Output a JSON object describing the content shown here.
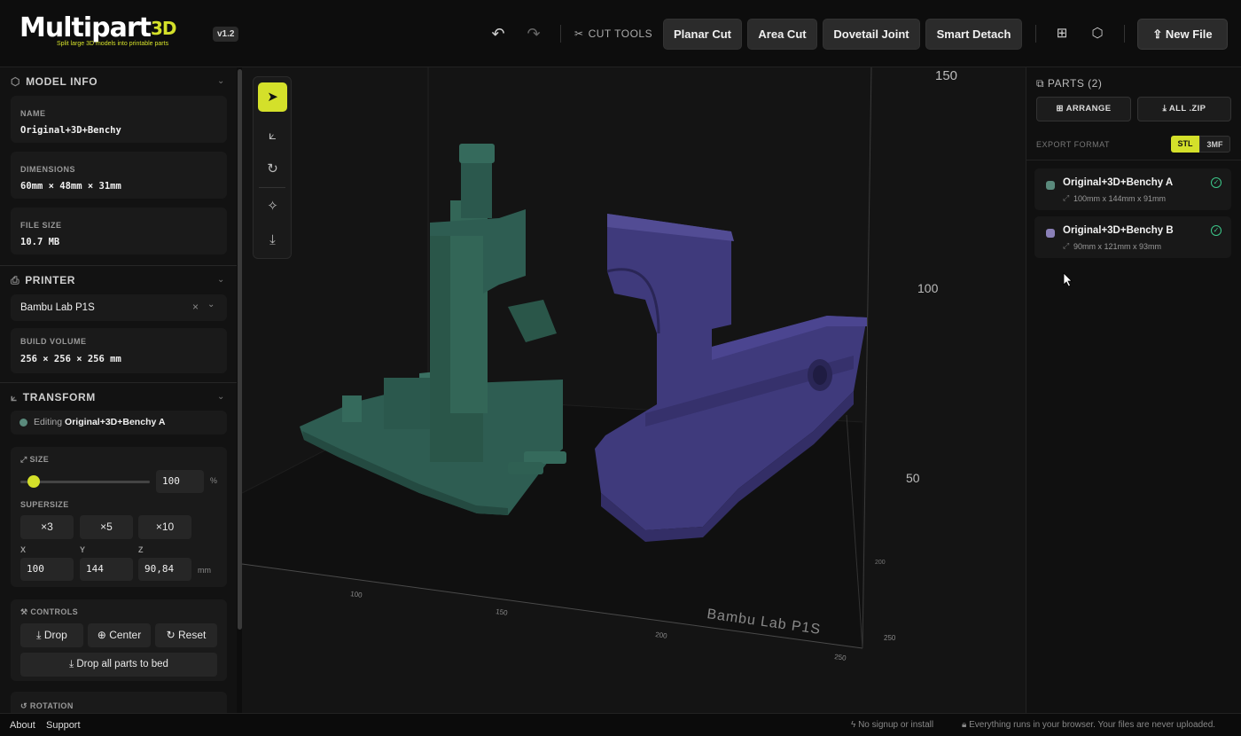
{
  "app": {
    "logo_word": "Multipart",
    "logo_accent": "3D",
    "tagline": "Split large 3D models into printable parts",
    "version": "v1.2"
  },
  "header": {
    "cut_tools_label": "CUT TOOLS",
    "tools": [
      "Planar Cut",
      "Area Cut",
      "Dovetail Joint",
      "Smart Detach"
    ],
    "new_file": "New File"
  },
  "model_info": {
    "title": "MODEL INFO",
    "name_label": "NAME",
    "name": "Original+3D+Benchy",
    "dimensions_label": "DIMENSIONS",
    "dimensions": "60mm × 48mm × 31mm",
    "file_size_label": "FILE SIZE",
    "file_size": "10.7 MB"
  },
  "printer": {
    "title": "PRINTER",
    "selected": "Bambu Lab P1S",
    "build_volume_label": "BUILD VOLUME",
    "build_volume": "256 × 256 × 256 mm"
  },
  "transform": {
    "title": "TRANSFORM",
    "editing_prefix": "Editing",
    "editing_part": "Original+3D+Benchy A",
    "size_label": "SIZE",
    "size_value": "100",
    "size_unit": "%",
    "slider_fraction": 0.1,
    "supersize_label": "SUPERSIZE",
    "supersize": [
      "×3",
      "×5",
      "×10"
    ],
    "x_label": "X",
    "y_label": "Y",
    "z_label": "Z",
    "x": "100",
    "y": "144",
    "z": "90,84",
    "unit": "mm"
  },
  "controls": {
    "title": "CONTROLS",
    "drop": "Drop",
    "center": "Center",
    "reset": "Reset",
    "drop_all": "Drop all parts to bed"
  },
  "rotation": {
    "title": "ROTATION"
  },
  "viewport": {
    "printer_label": "Bambu Lab P1S",
    "z_ticks": [
      "150",
      "100",
      "50"
    ],
    "x_ticks": [
      "100",
      "150",
      "200",
      "250"
    ],
    "y_ticks": [
      "200",
      "250"
    ],
    "part_a_color": "#2e5d52",
    "part_b_color": "#3f3a7c"
  },
  "parts": {
    "title": "PARTS (2)",
    "arrange": "ARRANGE",
    "all_zip": "ALL .ZIP",
    "export_format_label": "EXPORT FORMAT",
    "formats": [
      "STL",
      "3MF"
    ],
    "selected_format": "STL",
    "items": [
      {
        "name": "Original+3D+Benchy A",
        "dims": "100mm x 144mm x 91mm",
        "color": "#5a8a7c"
      },
      {
        "name": "Original+3D+Benchy B",
        "dims": "90mm x 121mm x 93mm",
        "color": "#8a80b8"
      }
    ]
  },
  "footer": {
    "about": "About",
    "support": "Support",
    "no_signup": "No signup or install",
    "privacy": "Everything runs in your browser. Your files are never uploaded."
  },
  "colors": {
    "accent": "#d4e02a",
    "ok": "#3cc88a"
  }
}
